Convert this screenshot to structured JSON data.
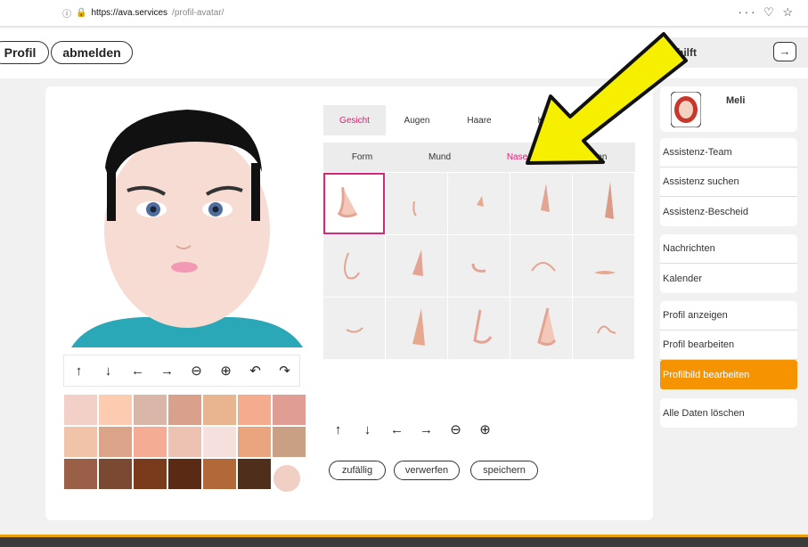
{
  "browser": {
    "url_host": "https://ava.services",
    "url_path": "/profil-avatar/",
    "tools": "··· ♡ ☆"
  },
  "header": {
    "profil_label": "Profil",
    "logout_label": "abmelden",
    "help_label": "a hilft",
    "next_icon": "arrow-right-icon"
  },
  "editor": {
    "tabs": [
      {
        "label": "Gesicht"
      },
      {
        "label": "Augen"
      },
      {
        "label": "Haare"
      },
      {
        "label": "Kl"
      }
    ],
    "subtabs": [
      {
        "label": "Form"
      },
      {
        "label": "Mund"
      },
      {
        "label": "Nase"
      },
      {
        "label": "Ohren"
      }
    ],
    "selected_tab": "Gesicht",
    "selected_subtab": "Nase",
    "accent": "#e01e74"
  },
  "actions": {
    "random": "zufällig",
    "discard": "verwerfen",
    "save": "speichern"
  },
  "controls": [
    "arrow-up-icon",
    "arrow-down-icon",
    "arrow-left-icon",
    "arrow-right-icon",
    "zoom-out-icon",
    "zoom-in-icon",
    "undo-icon",
    "redo-icon"
  ],
  "palette": [
    "#f2d0c8",
    "#fdcbb0",
    "#d9b6a8",
    "#d9a08c",
    "#e8b590",
    "#f4ab8e",
    "#df9d94",
    "#f1c4aa",
    "#dba488",
    "#f4ad94",
    "#eec2b2",
    "#f6e0dd",
    "#eaa57f",
    "#caa085",
    "#9a6047",
    "#7b4832",
    "#7a3b1c",
    "#5a2a14",
    "#b2693a",
    "#4f2e1c",
    "#f2cfc5"
  ],
  "sidebar": {
    "user_name": "Meli",
    "groups": [
      [
        "Assistenz-Team",
        "Assistenz suchen",
        "Assistenz-Bescheid"
      ],
      [
        "Nachrichten",
        "Kalender"
      ],
      [
        "Profil anzeigen",
        "Profil bearbeiten",
        "Profilbild bearbeiten"
      ],
      [
        "Alle Daten löschen"
      ]
    ],
    "active_item": "Profilbild bearbeiten",
    "active_color": "#f59400"
  }
}
